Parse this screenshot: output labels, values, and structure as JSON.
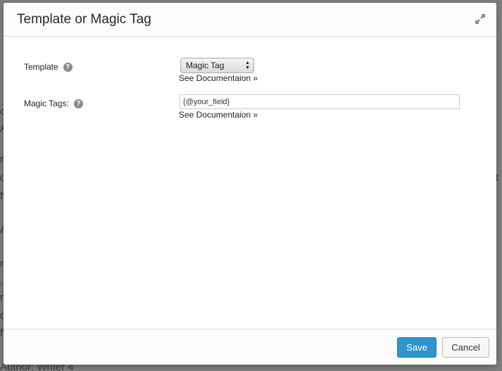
{
  "background": {
    "fragments": [
      "o",
      "A",
      "r",
      "d",
      "N",
      "A",
      "r",
      ",",
      "r",
      "d",
      "N",
      "t",
      "Author: Writer 4"
    ]
  },
  "modal": {
    "title": "Template or Magic Tag",
    "expand_icon": "expand-arrows-icon"
  },
  "form": {
    "template": {
      "label": "Template",
      "help_icon": "question-circle-icon",
      "selected": "Magic Tag",
      "doc_link": "See Documentaion »"
    },
    "magic_tags": {
      "label": "Magic Tags:",
      "help_icon": "question-circle-icon",
      "value": "{@your_field}",
      "doc_link": "See Documentaion »"
    }
  },
  "footer": {
    "save_label": "Save",
    "cancel_label": "Cancel"
  },
  "colors": {
    "overlay": "#7f7f7f",
    "primary": "#2e95cf"
  }
}
